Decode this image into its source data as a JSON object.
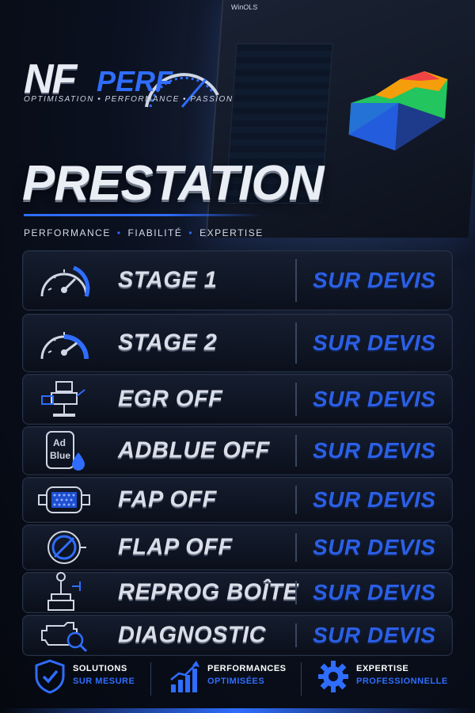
{
  "brand": {
    "logo_nf": "NF",
    "logo_perf": "PERF",
    "tagline": "OPTIMISATION • PERFORMANCE • PASSION"
  },
  "laptop": {
    "window_title": "WinOLS"
  },
  "hero": {
    "title": "PRESTATION",
    "subtitle_items": [
      "PERFORMANCE",
      "FIABILITÉ",
      "EXPERTISE"
    ]
  },
  "services": [
    {
      "name": "STAGE 1",
      "price": "SUR DEVIS",
      "icon": "speedometer-icon"
    },
    {
      "name": "STAGE 2",
      "price": "SUR DEVIS",
      "icon": "speedometer-icon"
    },
    {
      "name": "EGR OFF",
      "price": "SUR DEVIS",
      "icon": "egr-valve-icon"
    },
    {
      "name": "ADBLUE OFF",
      "price": "SUR DEVIS",
      "icon": "adblue-icon",
      "icon_text": [
        "Ad",
        "Blue"
      ]
    },
    {
      "name": "FAP OFF",
      "price": "SUR DEVIS",
      "icon": "particle-filter-icon"
    },
    {
      "name": "FLAP OFF",
      "price": "SUR DEVIS",
      "icon": "flap-valve-icon"
    },
    {
      "name": "REPROG BOÎTE",
      "price": "SUR DEVIS",
      "icon": "gearbox-icon"
    },
    {
      "name": "DIAGNOSTIC",
      "price": "SUR DEVIS",
      "icon": "engine-diagnostic-icon"
    }
  ],
  "features": [
    {
      "line1": "SOLUTIONS",
      "line2": "SUR MESURE",
      "icon": "shield-check-icon"
    },
    {
      "line1": "PERFORMANCES",
      "line2": "OPTIMISÉES",
      "icon": "growth-chart-icon"
    },
    {
      "line1": "EXPERTISE",
      "line2": "PROFESSIONNELLE",
      "icon": "gear-icon"
    }
  ],
  "colors": {
    "accent": "#2f6dff",
    "price": "#2b5fe6",
    "background": "#0b1120"
  }
}
